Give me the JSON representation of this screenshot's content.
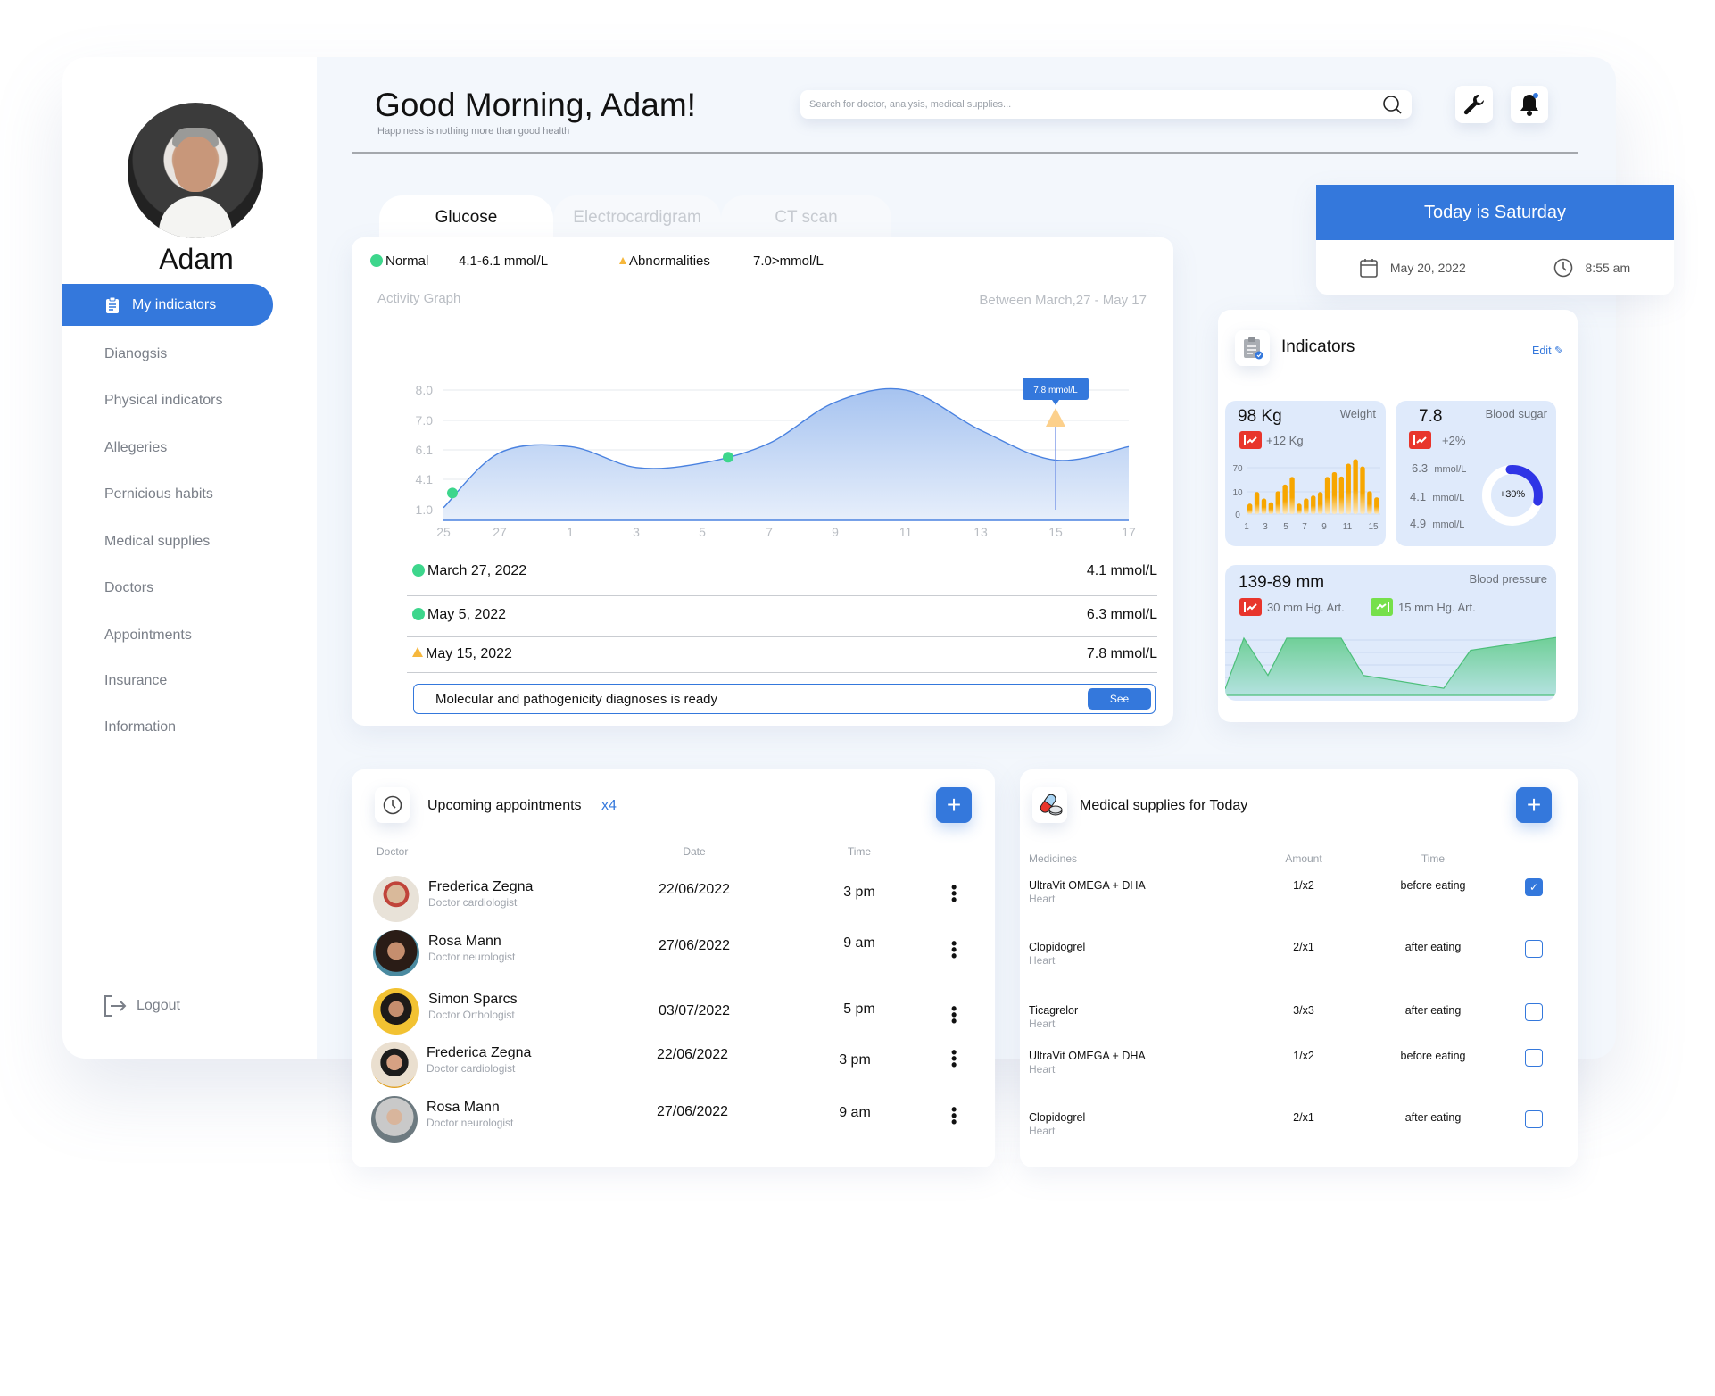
{
  "user": {
    "name": "Adam"
  },
  "sidebar": {
    "active": "My indicators",
    "items": [
      "Dianogsis",
      "Physical indicators",
      "Allegeries",
      "Pernicious habits",
      "Medical supplies",
      "Doctors",
      "Appointments",
      "Insurance",
      "Information"
    ],
    "logout": "Logout"
  },
  "header": {
    "greeting": "Good Morning, Adam!",
    "subtitle": "Happiness is nothing more than good health",
    "search_placeholder": "Search for doctor, analysis, medical supplies...",
    "icons": [
      "wrench-icon",
      "bell-icon"
    ]
  },
  "tabs": [
    "Glucose",
    "Electrocardigram",
    "CT scan"
  ],
  "glucose": {
    "legend_normal": "Normal",
    "legend_normal_range": "4.1-6.1 mmol/L",
    "legend_abnormal": "Abnormalities",
    "legend_abnormal_range": "7.0>mmol/L",
    "graph_title": "Activity Graph",
    "period": "Between March,27 -  May 17",
    "rows": [
      {
        "date": "March 27, 2022",
        "value": "4.1 mmol/L",
        "status": "normal"
      },
      {
        "date": "May 5, 2022",
        "value": "6.3 mmol/L",
        "status": "normal"
      },
      {
        "date": "May 15, 2022",
        "value": "7.8 mmol/L",
        "status": "abnormal"
      }
    ],
    "banner": "Molecular and pathogenicity diagnoses is ready",
    "banner_button": "See"
  },
  "today": {
    "title": "Today is Saturday",
    "date": "May 20, 2022",
    "time": "8:55 am"
  },
  "indicators": {
    "title": "Indicators",
    "edit": "Edit",
    "weight": {
      "value": "98 Kg",
      "label": "Weight",
      "change": "+12 Kg"
    },
    "sugar": {
      "value": "7.8",
      "label": "Blood sugar",
      "change": "+2%",
      "readings": [
        {
          "v": "6.3",
          "u": "mmol/L"
        },
        {
          "v": "4.1",
          "u": "mmol/L"
        },
        {
          "v": "4.9",
          "u": "mmol/L"
        }
      ],
      "donut_label": "+30%"
    },
    "pressure": {
      "value": "139-89 mm",
      "label": "Blood pressure",
      "up": "30 mm Hg. Art.",
      "down": "15 mm Hg. Art."
    }
  },
  "appointments": {
    "title": "Upcoming appointments",
    "count": "x4",
    "headers": [
      "Doctor",
      "Date",
      "Time"
    ],
    "rows": [
      {
        "name": "Frederica Zegna",
        "role": "Doctor cardiologist",
        "date": "22/06/2022",
        "time": "3 pm"
      },
      {
        "name": "Rosa Mann",
        "role": "Doctor neurologist",
        "date": "27/06/2022",
        "time": "9 am"
      },
      {
        "name": "Simon Sparcs",
        "role": "Doctor Orthologist",
        "date": "03/07/2022",
        "time": "5 pm"
      },
      {
        "name": "Frederica Zegna",
        "role": "Doctor cardiologist",
        "date": "22/06/2022",
        "time": "3 pm"
      },
      {
        "name": "Rosa Mann",
        "role": "Doctor neurologist",
        "date": "27/06/2022",
        "time": "9 am"
      }
    ]
  },
  "medical": {
    "title": "Medical supplies for Today",
    "headers": [
      "Medicines",
      "Amount",
      "Time"
    ],
    "rows": [
      {
        "name": "UltraVit OMEGA + DHA",
        "sub": "Heart",
        "amount": "1/x2",
        "time": "before eating",
        "checked": true
      },
      {
        "name": "Clopidogrel",
        "sub": "Heart",
        "amount": "2/x1",
        "time": "after eating",
        "checked": false
      },
      {
        "name": "Ticagrelor",
        "sub": "Heart",
        "amount": "3/x3",
        "time": "after eating",
        "checked": false
      },
      {
        "name": "UltraVit OMEGA + DHA",
        "sub": "Heart",
        "amount": "1/x2",
        "time": "before eating",
        "checked": false
      },
      {
        "name": "Clopidogrel",
        "sub": "Heart",
        "amount": "2/x1",
        "time": "after eating",
        "checked": false
      }
    ]
  },
  "colors": {
    "accent": "#3478dc",
    "normal": "#3dd68c",
    "abnormal": "#f6b73c",
    "alert": "#e8352c",
    "good": "#76e04a",
    "bars": "#f7a600",
    "donut": "#2f35e6",
    "pressure": "#6fcf97"
  },
  "chart_data": [
    {
      "type": "area",
      "x_ticks": [
        "25",
        "27",
        "1",
        "3",
        "5",
        "7",
        "9",
        "11",
        "13",
        "15",
        "17"
      ],
      "y_ticks": [
        8.0,
        7.0,
        6.1,
        4.1,
        1.0
      ],
      "y_tick_labels": [
        "8.0",
        "7.0",
        "6.1",
        "4.1",
        "1.0"
      ],
      "grid": true,
      "values": [
        1.2,
        5.9,
        6.2,
        4.9,
        5.2,
        6.3,
        7.6,
        8.0,
        6.7,
        5.4,
        6.2
      ],
      "markers": [
        {
          "type": "normal",
          "y": 2.7
        },
        {
          "type": "normal",
          "y": 5.6
        },
        {
          "type": "abnormal",
          "x": "15",
          "y": 7.8
        }
      ],
      "tooltip": "7.8 mmol/L"
    },
    {
      "type": "bar",
      "y_ticks": [
        0,
        10,
        70
      ],
      "x_ticks": [
        "1",
        "3",
        "5",
        "7",
        "9",
        "11",
        "15"
      ],
      "values": [
        4.7,
        9.9,
        7,
        5.3,
        11.5,
        28,
        47,
        4.7,
        7,
        8.3,
        9.9,
        47,
        59,
        48,
        80,
        91,
        73,
        11.5,
        7.5
      ]
    },
    {
      "type": "pie",
      "values": [
        30,
        70
      ],
      "label": "+30%"
    },
    {
      "type": "area",
      "values": [
        10,
        89,
        31,
        89,
        89,
        31,
        11,
        70,
        90
      ]
    }
  ]
}
